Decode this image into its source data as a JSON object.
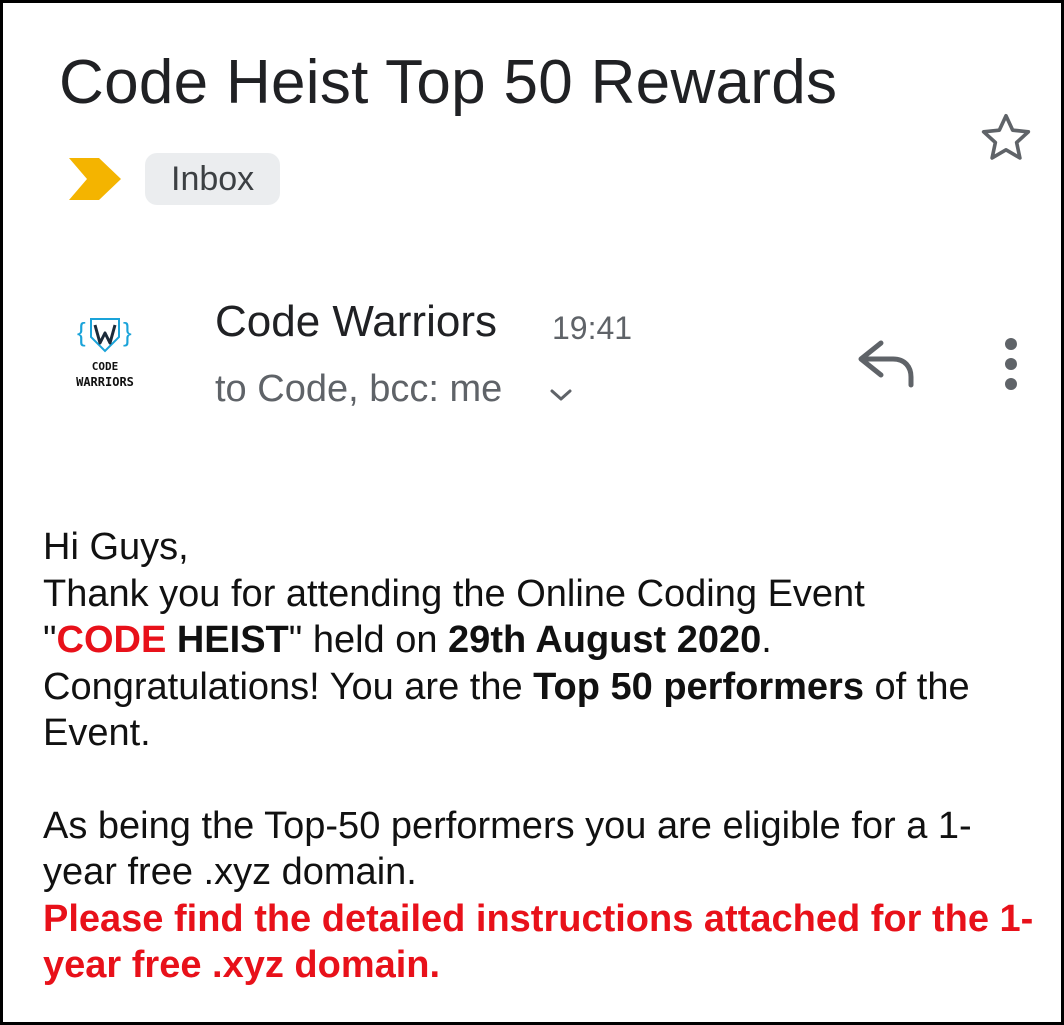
{
  "email": {
    "subject": "Code Heist Top 50 Rewards",
    "label": "Inbox",
    "sender": {
      "name": "Code Warriors",
      "time": "19:41",
      "recipients": "to Code, bcc: me",
      "avatar_logo_text": [
        "CODE",
        "WARRIORS"
      ]
    },
    "body": {
      "greeting": "Hi Guys,",
      "p1_line1": "Thank you for attending the Online Coding Event",
      "p1_quote_open": "\"",
      "p1_event_red": "CODE",
      "p1_event_black": " HEIST",
      "p1_quote_close": "\" held on ",
      "p1_date": "29th August 2020",
      "p1_end": ".",
      "p2_start": "Congratulations! You are the ",
      "p2_bold": "Top 50 performers",
      "p2_end": " of the Event.",
      "p3": "As being the Top-50 performers you are eligible for a 1-year free .xyz domain.",
      "notice": "Please find the detailed instructions attached for the 1-year free .xyz domain."
    }
  },
  "icons": {
    "star": "star-outline-icon",
    "importance": "importance-marker-icon",
    "reply": "reply-icon",
    "more": "more-vertical-icon",
    "expand": "chevron-down-icon"
  },
  "colors": {
    "importance": "#f4b400",
    "highlight_red": "#e8111a",
    "logo_blue": "#1aa3d9",
    "chip_bg": "#ebedef",
    "secondary_text": "#5f6368"
  }
}
